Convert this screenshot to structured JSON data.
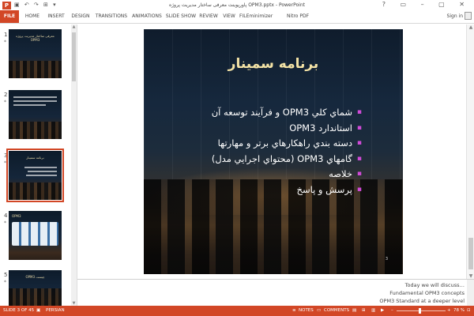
{
  "titlebar": {
    "app_logo": "P",
    "qat_icons": "▣ ↶ ↷ ⊞ ▾",
    "title": "پاورپوینت معرفی ساختار مدیریت پروژه OPM3.pptx - PowerPoint",
    "window_buttons": "? ▭ – ▢ ✕"
  },
  "ribbon": {
    "tabs": [
      "FILE",
      "HOME",
      "INSERT",
      "DESIGN",
      "TRANSITIONS",
      "ANIMATIONS",
      "SLIDE SHOW",
      "REVIEW",
      "VIEW",
      "FILEminimizer",
      "Nitro PDF Professional"
    ],
    "signin": "Sign in"
  },
  "thumbnails": {
    "items": [
      {
        "number": "1",
        "star": "*",
        "title": "معرفی ساختار مدیریت پروژه OPM3"
      },
      {
        "number": "2",
        "star": "*",
        "title": ""
      },
      {
        "number": "3",
        "star": "*",
        "title": "برنامه سمینار"
      },
      {
        "number": "4",
        "star": "*",
        "title": "OPM3"
      },
      {
        "number": "5",
        "star": "*",
        "title": "OPM3 چیست"
      }
    ],
    "selected_index": 2
  },
  "slide": {
    "title": "برنامه سمينار",
    "bullets": [
      "شماي كلي OPM3 و فرآيند توسعه آن",
      "استاندارد OPM3",
      "دسته بندي راهكارهاي برتر و مهارتها",
      "گامهاي OPM3 (محتواي اجرايي مدل)",
      "خلاصه",
      "پرسش و پاسخ"
    ],
    "bullet_glyph": "▪",
    "slide_number": "3",
    "colors": {
      "title": "#f4e3a6",
      "bullet": "#d04bd8",
      "text": "#ffffff"
    }
  },
  "notes": {
    "lines": [
      "Today we will discuss…",
      "Fundamental OPM3 concepts",
      "OPM3 Standard at a deeper level"
    ]
  },
  "statusbar": {
    "slide_indicator": "SLIDE 3 OF 45",
    "language": "PERSIAN",
    "notes_label": "NOTES",
    "comments_label": "COMMENTS",
    "zoom": "78 %",
    "zoom_minus": "–",
    "zoom_plus": "+",
    "accent": "#d24726"
  }
}
